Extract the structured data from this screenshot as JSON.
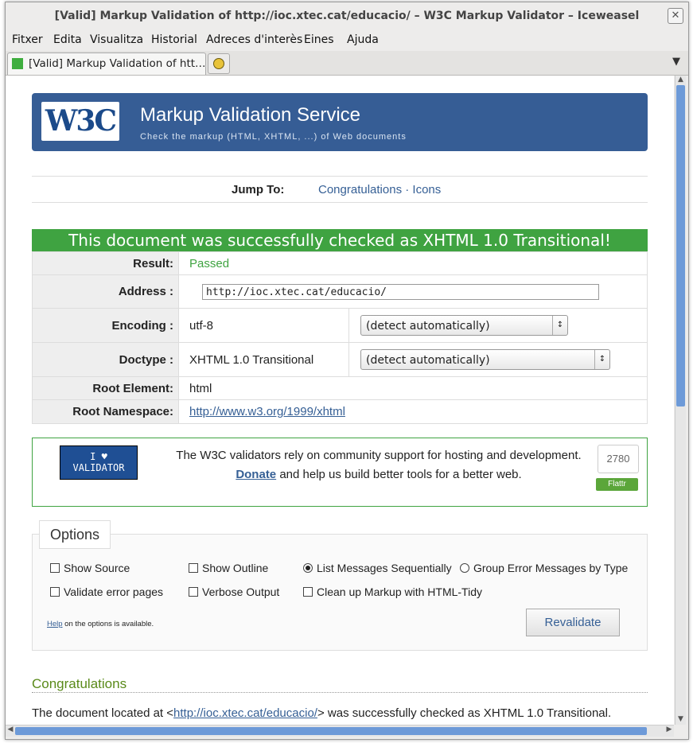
{
  "window": {
    "title": "[Valid] Markup Validation of http://ioc.xtec.cat/educacio/ – W3C Markup Validator – Iceweasel",
    "close_symbol": "✕"
  },
  "menu": [
    "Fitxer",
    "Edita",
    "Visualitza",
    "Historial",
    "Adreces d'interès",
    "Eines",
    "Ajuda"
  ],
  "tab": {
    "label": "[Valid] Markup Validation of htt…"
  },
  "header": {
    "logo_text": "W3C",
    "title": "Markup Validation Service",
    "subtitle": "Check the markup (HTML, XHTML, ...) of Web documents"
  },
  "jump": {
    "label": "Jump To:",
    "links": "Congratulations · Icons"
  },
  "success_message": "This document was successfully checked as XHTML 1.0 Transitional!",
  "results": {
    "result_label": "Result:",
    "result_value": "Passed",
    "address_label": "Address :",
    "address_value": "http://ioc.xtec.cat/educacio/",
    "encoding_label": "Encoding :",
    "encoding_value": "utf-8",
    "encoding_select": "(detect automatically)",
    "doctype_label": "Doctype :",
    "doctype_value": "XHTML 1.0 Transitional",
    "doctype_select": "(detect automatically)",
    "root_element_label": "Root Element:",
    "root_element_value": "html",
    "root_ns_label": "Root Namespace:",
    "root_ns_value": "http://www.w3.org/1999/xhtml"
  },
  "donate": {
    "badge_line1": "I ♥",
    "badge_line2": "VALIDATOR",
    "text_before": "The W3C validators rely on community support for hosting and development.",
    "donate_link": "Donate",
    "text_after": " and help us build better tools for a better web.",
    "flattr_count": "2780",
    "flattr_label": "Flattr"
  },
  "options": {
    "legend": "Options",
    "show_source": "Show Source",
    "show_outline": "Show Outline",
    "list_sequential": "List Messages Sequentially",
    "group_by_type": "Group Error Messages by Type",
    "validate_error_pages": "Validate error pages",
    "verbose_output": "Verbose Output",
    "cleanup_tidy": "Clean up Markup with HTML-Tidy",
    "help_link": "Help",
    "help_text": " on the options is available.",
    "revalidate": "Revalidate"
  },
  "congrats": {
    "heading": "Congratulations",
    "text_before": "The document located at <",
    "link": "http://ioc.xtec.cat/educacio/",
    "text_after": "> was successfully checked as XHTML 1.0 Transitional."
  }
}
